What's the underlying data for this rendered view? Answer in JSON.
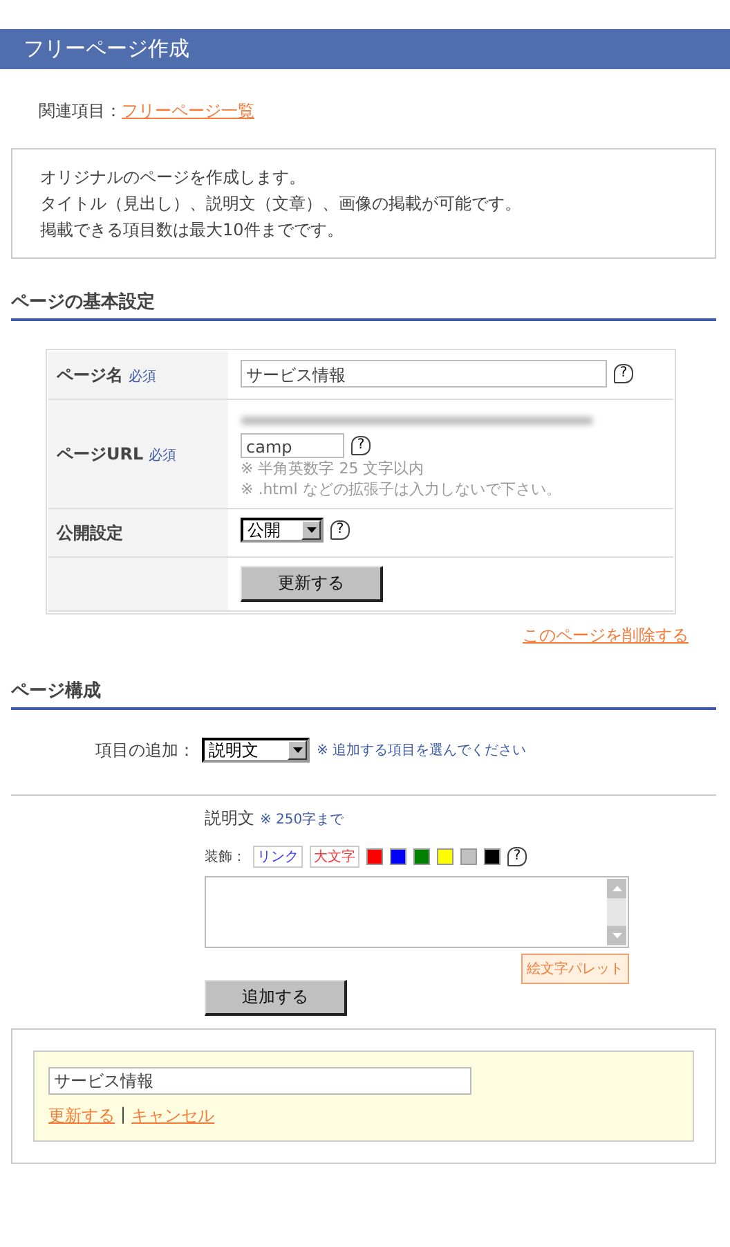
{
  "page_title": "フリーページ作成",
  "related": {
    "label": "関連項目：",
    "link": "フリーページ一覧"
  },
  "intro": [
    "オリジナルのページを作成します。",
    "タイトル（見出し）、説明文（文章）、画像の掲載が可能です。",
    "掲載できる項目数は最大10件までです。"
  ],
  "basic_settings": {
    "title": "ページの基本設定",
    "rows": [
      {
        "kind": "text",
        "label": "ページ名",
        "required": "必須",
        "value": "サービス情報",
        "help": "?"
      },
      {
        "kind": "url",
        "label": "ページURL",
        "required": "必須",
        "value": "camp",
        "help": "?",
        "notes": [
          "※ 半角英数字 25 文字以内",
          "※ .html などの拡張子は入力しないで下さい。"
        ]
      },
      {
        "kind": "select",
        "label": "公開設定",
        "value": "公開",
        "help": "?"
      },
      {
        "kind": "button",
        "button": "更新する"
      }
    ],
    "delete_link": "このページを削除する"
  },
  "structure": {
    "title": "ページ構成",
    "add_label": "項目の追加：",
    "add_select": "説明文",
    "add_hint": "※ 追加する項目を選んでください",
    "editor": {
      "title": "説明文",
      "limit": "※ 250字まで",
      "decoration_label": "装飾：",
      "link_button": "リンク",
      "large_button": "大文字",
      "colors": [
        {
          "color": "#ff0000"
        },
        {
          "color": "#0000ff"
        },
        {
          "color": "#008000"
        },
        {
          "color": "#ffff00"
        },
        {
          "color": "#c0c0c0"
        },
        {
          "color": "#000000"
        }
      ],
      "help": "?",
      "emoji_button": "絵文字パレット",
      "submit": "追加する"
    }
  },
  "items": [
    {
      "value": "サービス情報",
      "update": "更新する",
      "separator": "|",
      "cancel": "キャンセル"
    }
  ]
}
